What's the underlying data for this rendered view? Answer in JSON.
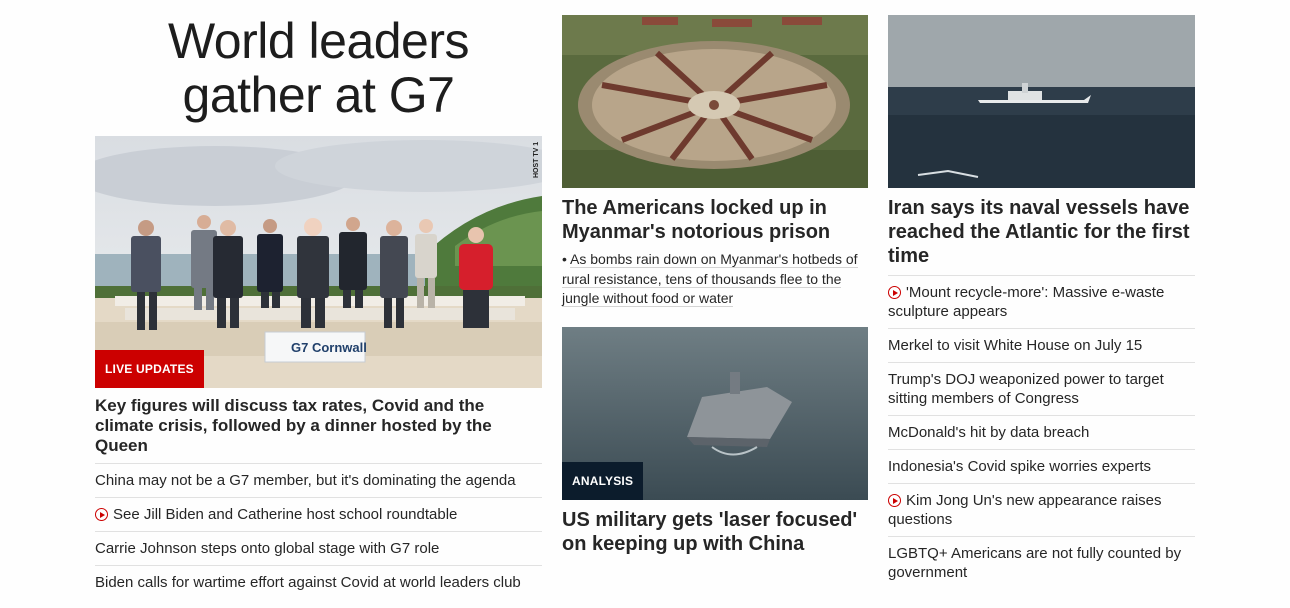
{
  "col1": {
    "big_title": "World leaders gather at G7",
    "hero_badge": "LIVE UPDATES",
    "hero_watermark": "HOST TV 1",
    "banner_text": "G7 Cornwall",
    "headline": "Key figures will discuss tax rates, Covid and the climate crisis, followed by a dinner hosted by the Queen",
    "items": [
      {
        "text": "China may not be a G7 member, but it's dominating the agenda",
        "video": false
      },
      {
        "text": "See Jill Biden and Catherine host school roundtable",
        "video": true
      },
      {
        "text": "Carrie Johnson steps onto global stage with G7 role",
        "video": false
      },
      {
        "text": "Biden calls for wartime effort against Covid at world leaders club",
        "video": false
      }
    ]
  },
  "col2": {
    "story1": {
      "headline": "The Americans locked up in Myanmar's notorious prison",
      "teaser_bullet": "•",
      "teaser": "As bombs rain down on Myanmar's hotbeds of rural resistance, tens of thousands flee to the jungle without food or water"
    },
    "story2": {
      "badge": "ANALYSIS",
      "headline": "US military gets 'laser focused' on keeping up with China"
    }
  },
  "col3": {
    "headline": "Iran says its naval vessels have reached the Atlantic for the first time",
    "items": [
      {
        "text": "'Mount recycle-more': Massive e-waste sculpture appears",
        "video": true
      },
      {
        "text": "Merkel to visit White House on July 15",
        "video": false
      },
      {
        "text": "Trump's DOJ weaponized power to target sitting members of Congress",
        "video": false
      },
      {
        "text": "McDonald's hit by data breach",
        "video": false
      },
      {
        "text": "Indonesia's Covid spike worries experts",
        "video": false
      },
      {
        "text": "Kim Jong Un's new appearance raises questions",
        "video": true
      },
      {
        "text": "LGBTQ+ Americans are not fully counted by government",
        "video": false
      }
    ]
  },
  "colors": {
    "live_red": "#cc0000",
    "analysis_navy": "#0c1c2c",
    "text": "#262626",
    "divider": "#e1e1e1"
  }
}
